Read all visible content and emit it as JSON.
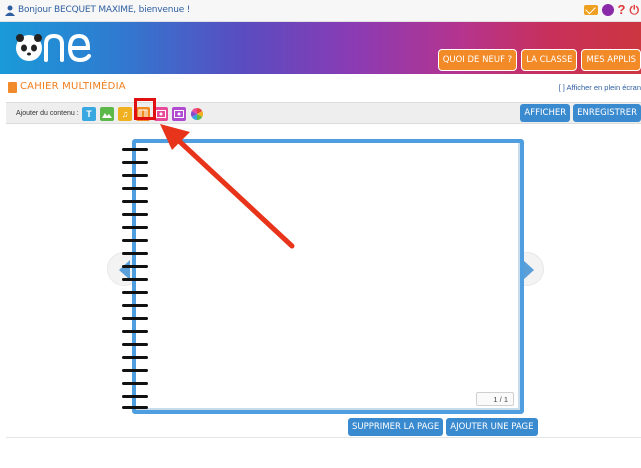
{
  "topbar": {
    "greeting": "Bonjour BECQUET MAXIME, bienvenue !",
    "icons": [
      "user-icon",
      "mail-icon",
      "account-icon",
      "help-icon",
      "power-icon"
    ],
    "help_glyph": "?",
    "power_glyph": "⏻"
  },
  "banner": {
    "logo_text": "one",
    "nav": [
      "QUOI DE NEUF ?",
      "LA CLASSE",
      "MES APPLIS"
    ]
  },
  "page": {
    "title": "CAHIER MULTIMÉDIA",
    "fullscreen": "[ ] Afficher en plein écran"
  },
  "toolbar": {
    "add_label": "Ajouter du contenu :",
    "tools": [
      {
        "name": "text-tool-icon",
        "glyph": "T"
      },
      {
        "name": "image-tool-icon",
        "glyph": ""
      },
      {
        "name": "audio-tool-icon",
        "glyph": "♫"
      },
      {
        "name": "video-tool-icon",
        "glyph": ""
      },
      {
        "name": "embed-tool-icon",
        "glyph": ""
      },
      {
        "name": "frame-tool-icon",
        "glyph": ""
      },
      {
        "name": "color-tool-icon",
        "glyph": ""
      }
    ],
    "afficher": "AFFICHER",
    "enregistrer": "ENREGISTRER"
  },
  "notebook": {
    "page_counter": "1 / 1",
    "delete_page": "SUPPRIMER LA PAGE",
    "add_page": "AJOUTER UNE PAGE"
  },
  "colors": {
    "accent_orange": "#f28a28",
    "accent_blue": "#3a8ad0",
    "highlight_red": "#e01010"
  }
}
